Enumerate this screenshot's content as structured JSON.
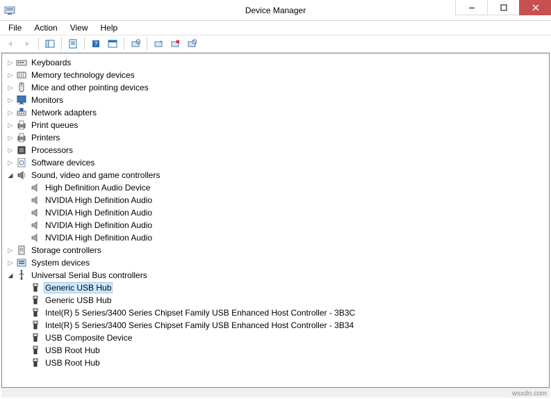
{
  "window": {
    "title": "Device Manager"
  },
  "menubar": {
    "file": "File",
    "action": "Action",
    "view": "View",
    "help": "Help"
  },
  "tree": {
    "categories": [
      {
        "label": "Keyboards",
        "icon": "keyboard",
        "expanded": false,
        "children": []
      },
      {
        "label": "Memory technology devices",
        "icon": "memory",
        "expanded": false,
        "children": []
      },
      {
        "label": "Mice and other pointing devices",
        "icon": "mouse",
        "expanded": false,
        "children": []
      },
      {
        "label": "Monitors",
        "icon": "monitor",
        "expanded": false,
        "children": []
      },
      {
        "label": "Network adapters",
        "icon": "network",
        "expanded": false,
        "children": []
      },
      {
        "label": "Print queues",
        "icon": "printer",
        "expanded": false,
        "children": []
      },
      {
        "label": "Printers",
        "icon": "printer",
        "expanded": false,
        "children": []
      },
      {
        "label": "Processors",
        "icon": "cpu",
        "expanded": false,
        "children": []
      },
      {
        "label": "Software devices",
        "icon": "software",
        "expanded": false,
        "children": []
      },
      {
        "label": "Sound, video and game controllers",
        "icon": "sound",
        "expanded": true,
        "children": [
          {
            "label": "High Definition Audio Device",
            "icon": "speaker"
          },
          {
            "label": "NVIDIA High Definition Audio",
            "icon": "speaker"
          },
          {
            "label": "NVIDIA High Definition Audio",
            "icon": "speaker"
          },
          {
            "label": "NVIDIA High Definition Audio",
            "icon": "speaker"
          },
          {
            "label": "NVIDIA High Definition Audio",
            "icon": "speaker"
          }
        ]
      },
      {
        "label": "Storage controllers",
        "icon": "storage",
        "expanded": false,
        "children": []
      },
      {
        "label": "System devices",
        "icon": "system",
        "expanded": false,
        "children": []
      },
      {
        "label": "Universal Serial Bus controllers",
        "icon": "usb",
        "expanded": true,
        "children": [
          {
            "label": "Generic USB Hub",
            "icon": "usb-plug",
            "selected": true
          },
          {
            "label": "Generic USB Hub",
            "icon": "usb-plug"
          },
          {
            "label": "Intel(R) 5 Series/3400 Series Chipset Family USB Enhanced Host Controller - 3B3C",
            "icon": "usb-plug"
          },
          {
            "label": "Intel(R) 5 Series/3400 Series Chipset Family USB Enhanced Host Controller - 3B34",
            "icon": "usb-plug"
          },
          {
            "label": "USB Composite Device",
            "icon": "usb-plug"
          },
          {
            "label": "USB Root Hub",
            "icon": "usb-plug"
          },
          {
            "label": "USB Root Hub",
            "icon": "usb-plug"
          }
        ]
      }
    ]
  },
  "watermark": "wsxdn.com"
}
